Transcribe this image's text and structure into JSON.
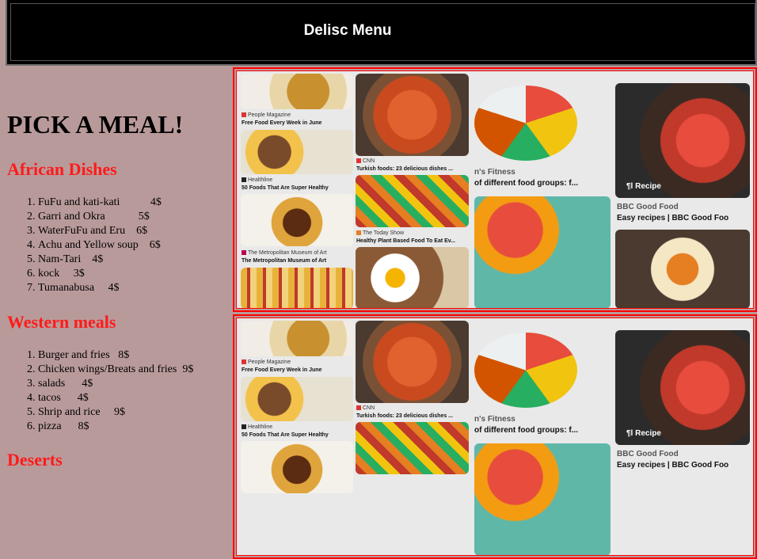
{
  "header": {
    "title": "Delisc Menu"
  },
  "menu": {
    "heading": "PICK A MEAL!",
    "sections": [
      {
        "title": "African Dishes",
        "items": [
          "FuFu and kati-kati           4$",
          "Garri and Okra            5$",
          "WaterFuFu and Eru    6$",
          "Achu and Yellow soup    6$",
          "Nam-Tari    4$",
          "kock     3$",
          "Tumanabusa     4$"
        ]
      },
      {
        "title": "Western meals",
        "items": [
          "Burger and fries   8$",
          "Chicken wings/Breats and fries  9$",
          "salads      4$",
          "tacos      4$",
          "Shrip and rice     9$",
          "pizza      8$"
        ]
      },
      {
        "title": "Deserts",
        "items": []
      }
    ]
  },
  "gallery": {
    "captions": {
      "people_source": "People Magazine",
      "people_desc": "Free Food Every Week in June",
      "cnn_source": "CNN",
      "cnn_desc": "Turkish foods: 23 delicious dishes ...",
      "healthline_source": "Healthline",
      "healthline_desc": "50 Foods That Are Super Healthy",
      "met_source": "The Metropolitan Museum of Art",
      "met_desc": "The Metropolitan Museum of Art",
      "today_source": "The Today Show",
      "today_desc": "Healthy Plant Based Food To Eat Ev...",
      "fitness_source": "n's Fitness",
      "fitness_desc": "of different food groups: f...",
      "bbc_source": "BBC Good Food",
      "bbc_desc": "Easy recipes | BBC Good Foo",
      "recipe_badge": "¶l Recipe"
    }
  },
  "colors": {
    "accent": "#ff1a1a",
    "background": "#b99a9a",
    "header": "#000000"
  }
}
